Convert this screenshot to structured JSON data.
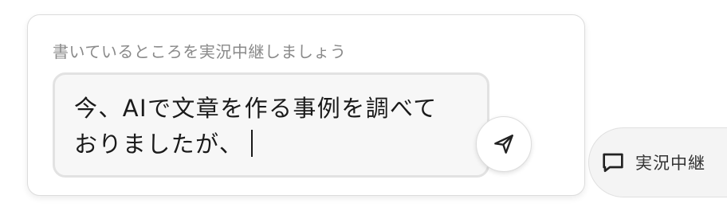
{
  "composer": {
    "label": "書いているところを実況中継しましょう",
    "text_line1": "今、AIで文章を作る事例を調べて",
    "text_line2": "おりましたが、",
    "send_icon": "send-icon"
  },
  "side_button": {
    "label": "実況中継",
    "icon": "chat-bubble-icon"
  }
}
